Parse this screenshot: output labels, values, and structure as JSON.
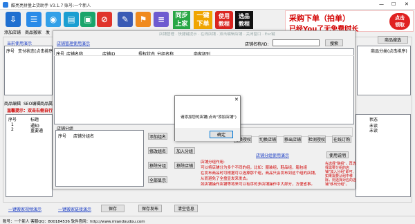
{
  "title_bar": {
    "title": "酷亮亮拼量上货助手 V3.1.7  账号:一个新人",
    "minimize": "—",
    "maximize": "☐",
    "close": "✕"
  },
  "toolbar": {
    "items": [
      "添加店铺",
      "商品搬家",
      "发",
      "",
      "",
      "",
      "",
      "",
      ""
    ],
    "tile_sync": "同步\n上家",
    "tile_onekey": "一键\n下单",
    "tile_tutorial": "使用\n教程",
    "tile_course": "选品\n教程"
  },
  "banner": {
    "line1": "采购下单（拍单）",
    "line2": "已经You了无免费时长",
    "badge": "点击\n领取"
  },
  "main": {
    "tutorial_link": "当前使用演示",
    "list_header_cols": [
      "序号",
      "支付状态(点击排序)"
    ],
    "right_button": "商品搜选",
    "right_col": "商品分类(点击排序)",
    "tabs": [
      "商品编辑",
      "SEO编辑",
      "商品属"
    ],
    "warn": "温馨提示：双击右侧自行",
    "lower_cols": [
      "序号",
      "标题"
    ],
    "lower_rows": [
      [
        "1",
        "通知:"
      ],
      [
        "2",
        "重要通"
      ]
    ],
    "right_status_hdr": "状态",
    "right_status": [
      "未读",
      "未读"
    ]
  },
  "shop_dialog": {
    "toolbar_faded": "店铺管理 · 快捷键提示 · 在线店铺 · 双击编辑店铺 · 关闭窗口 · Esc键",
    "tutorial_link": "店铺管理使用演示",
    "search_label": "店铺名称/ID:",
    "search_value": "",
    "search_button": "搜索",
    "grid_cols": [
      "序号",
      "店铺名称",
      "店铺ID",
      "授权状态",
      "分组名称",
      "商家级别"
    ],
    "group_label": "店铺分组",
    "group_cols": [
      "序号",
      "店铺分组名"
    ],
    "group_buttons": [
      "添加组名",
      "修改组名",
      "移除分组",
      "全部显示"
    ],
    "group_buttons2": [
      "",
      "加入分组",
      "移除店铺"
    ],
    "right_buttons": [
      "",
      "切换授权",
      "切换店铺",
      "移出店铺",
      "检测授权",
      "在线订购"
    ],
    "guide_link": "店铺分组使用演示",
    "guide_button": "使用说明",
    "guide_lines": [
      "店铺分组作用:",
      "可以将店铺分为多个不同的组，比如：服装组，鞋品组，箱包组",
      "在发布商品时可根据可以选择那个组，商品只会发布到这个组的店铺，",
      "从而避免了全盘显发来发去。",
      "如店铺操作店铺等将来可以有序的多店铺操作中大部分，方便省事。"
    ],
    "right_note": "先选择\"整组\"，再选择需要分组的店铺\"加入分组\"即可, 如果需要从组中移除，则选择对应的店铺\"移出分组\"。"
  },
  "alert": {
    "message": "请添加您的店铺(点击\"添加店铺\")",
    "ok": "确定",
    "close": "✕"
  },
  "footer": {
    "link1": "一键搬家视频演示",
    "link2": "一键搬家链接演示",
    "save": "保存",
    "save_publish": "保存发布",
    "clear": "清空信息",
    "status": "账号：一个新人    客服QQ：800184536    软件官网：http://www.miandoudou.com"
  }
}
